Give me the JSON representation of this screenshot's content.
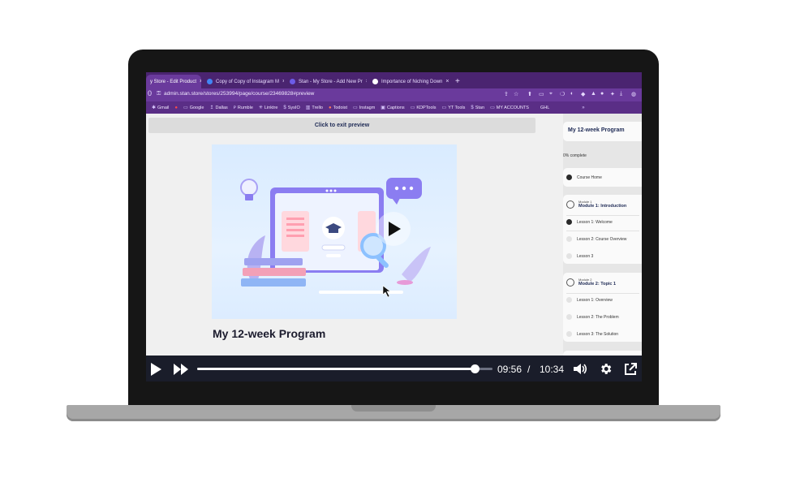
{
  "browser": {
    "tabs": [
      {
        "label": "y Store - Edit Product",
        "color": "#b0c4de"
      },
      {
        "label": "Copy of Copy of Instagram M",
        "color": "#4285f4"
      },
      {
        "label": "Stan - My Store - Add New Pr",
        "color": "#6c5ce7"
      },
      {
        "label": "Importance of Niching Down",
        "color": "#ffffff"
      }
    ],
    "new_tab": "+",
    "url": "admin.stan.store/stores/253994/page/course/23469828#preview",
    "bookmarks": [
      "Gmail",
      "Google",
      "Dallas",
      "Rumble",
      "Linktre",
      "SysIO",
      "Trello",
      "Todoist",
      "Instagm",
      "Captions",
      "KDPTools",
      "YT Tools",
      "Stan",
      "MY ACCOUNTS",
      "GHL"
    ]
  },
  "page": {
    "exit_preview": "Click to exit preview",
    "course_title": "My 12-week Program"
  },
  "sidebar": {
    "title": "My 12-week Program",
    "progress": "0% complete",
    "course_home": "Course Home",
    "modules": [
      {
        "small": "Module 1",
        "title": "Module 1: Introduction",
        "lessons": [
          "Lesson 1: Welcome",
          "Lesson 2: Course Overview",
          "Lesson 3"
        ]
      },
      {
        "small": "Module 2",
        "title": "Module 2: Topic 1",
        "lessons": [
          "Lesson 1: Overview",
          "Lesson 2: The Problem",
          "Lesson 3: The Solution"
        ]
      }
    ]
  },
  "player": {
    "current_time": "09:56",
    "separator": "/",
    "duration": "10:34",
    "progress": 0.9401
  },
  "colors": {
    "tab_bar": "#4a2470",
    "player_bg": "#1a1d2a",
    "accent_purple": "#7b6cf6"
  },
  "icons": [
    "play-icon",
    "fast-forward-icon",
    "volume-icon",
    "gear-icon",
    "external-link-icon",
    "star-icon",
    "share-icon"
  ]
}
